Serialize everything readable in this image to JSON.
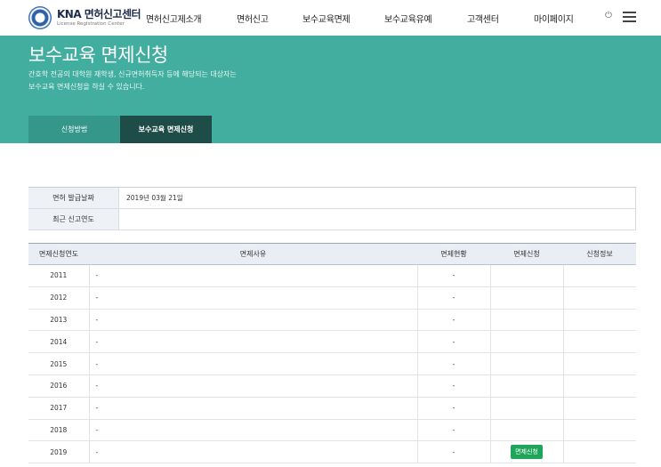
{
  "header": {
    "logo_title": "KNA 면허신고센터",
    "logo_subtitle": "License Registration Center",
    "nav": [
      "면허신고제소개",
      "면허신고",
      "보수교육면제",
      "보수교육유예",
      "고객센터",
      "마이페이지"
    ]
  },
  "banner": {
    "title": "보수교육 면제신청",
    "desc_line1": "간호학 전공의 대학원 재학생, 신규면허취득자 등에 해당되는 대상자는",
    "desc_line2": "보수교육 면제신청을 하실 수 있습니다.",
    "tabs": [
      {
        "label": "신청방법",
        "active": false
      },
      {
        "label": "보수교육 면제신청",
        "active": true
      }
    ]
  },
  "info": {
    "license_date_label": "면허 발급날짜",
    "license_date_value": "2019년 03월 21일",
    "recent_year_label": "최근 신고연도",
    "recent_year_value": ""
  },
  "table": {
    "headers": [
      "면제신청연도",
      "면제사유",
      "면제현황",
      "면제신청",
      "신청정보"
    ],
    "rows": [
      {
        "year": "2011",
        "reason": "-",
        "status": "-",
        "apply": "",
        "info": ""
      },
      {
        "year": "2012",
        "reason": "-",
        "status": "-",
        "apply": "",
        "info": ""
      },
      {
        "year": "2013",
        "reason": "-",
        "status": "-",
        "apply": "",
        "info": ""
      },
      {
        "year": "2014",
        "reason": "-",
        "status": "-",
        "apply": "",
        "info": ""
      },
      {
        "year": "2015",
        "reason": "-",
        "status": "-",
        "apply": "",
        "info": ""
      },
      {
        "year": "2016",
        "reason": "-",
        "status": "-",
        "apply": "",
        "info": ""
      },
      {
        "year": "2017",
        "reason": "-",
        "status": "-",
        "apply": "",
        "info": ""
      },
      {
        "year": "2018",
        "reason": "-",
        "status": "-",
        "apply": "",
        "info": ""
      },
      {
        "year": "2019",
        "reason": "-",
        "status": "-",
        "apply": "면제신청",
        "info": ""
      }
    ]
  },
  "colors": {
    "banner": "#42ae9f",
    "tab_active": "#1e4d49",
    "apply_button": "#1fa55a"
  }
}
